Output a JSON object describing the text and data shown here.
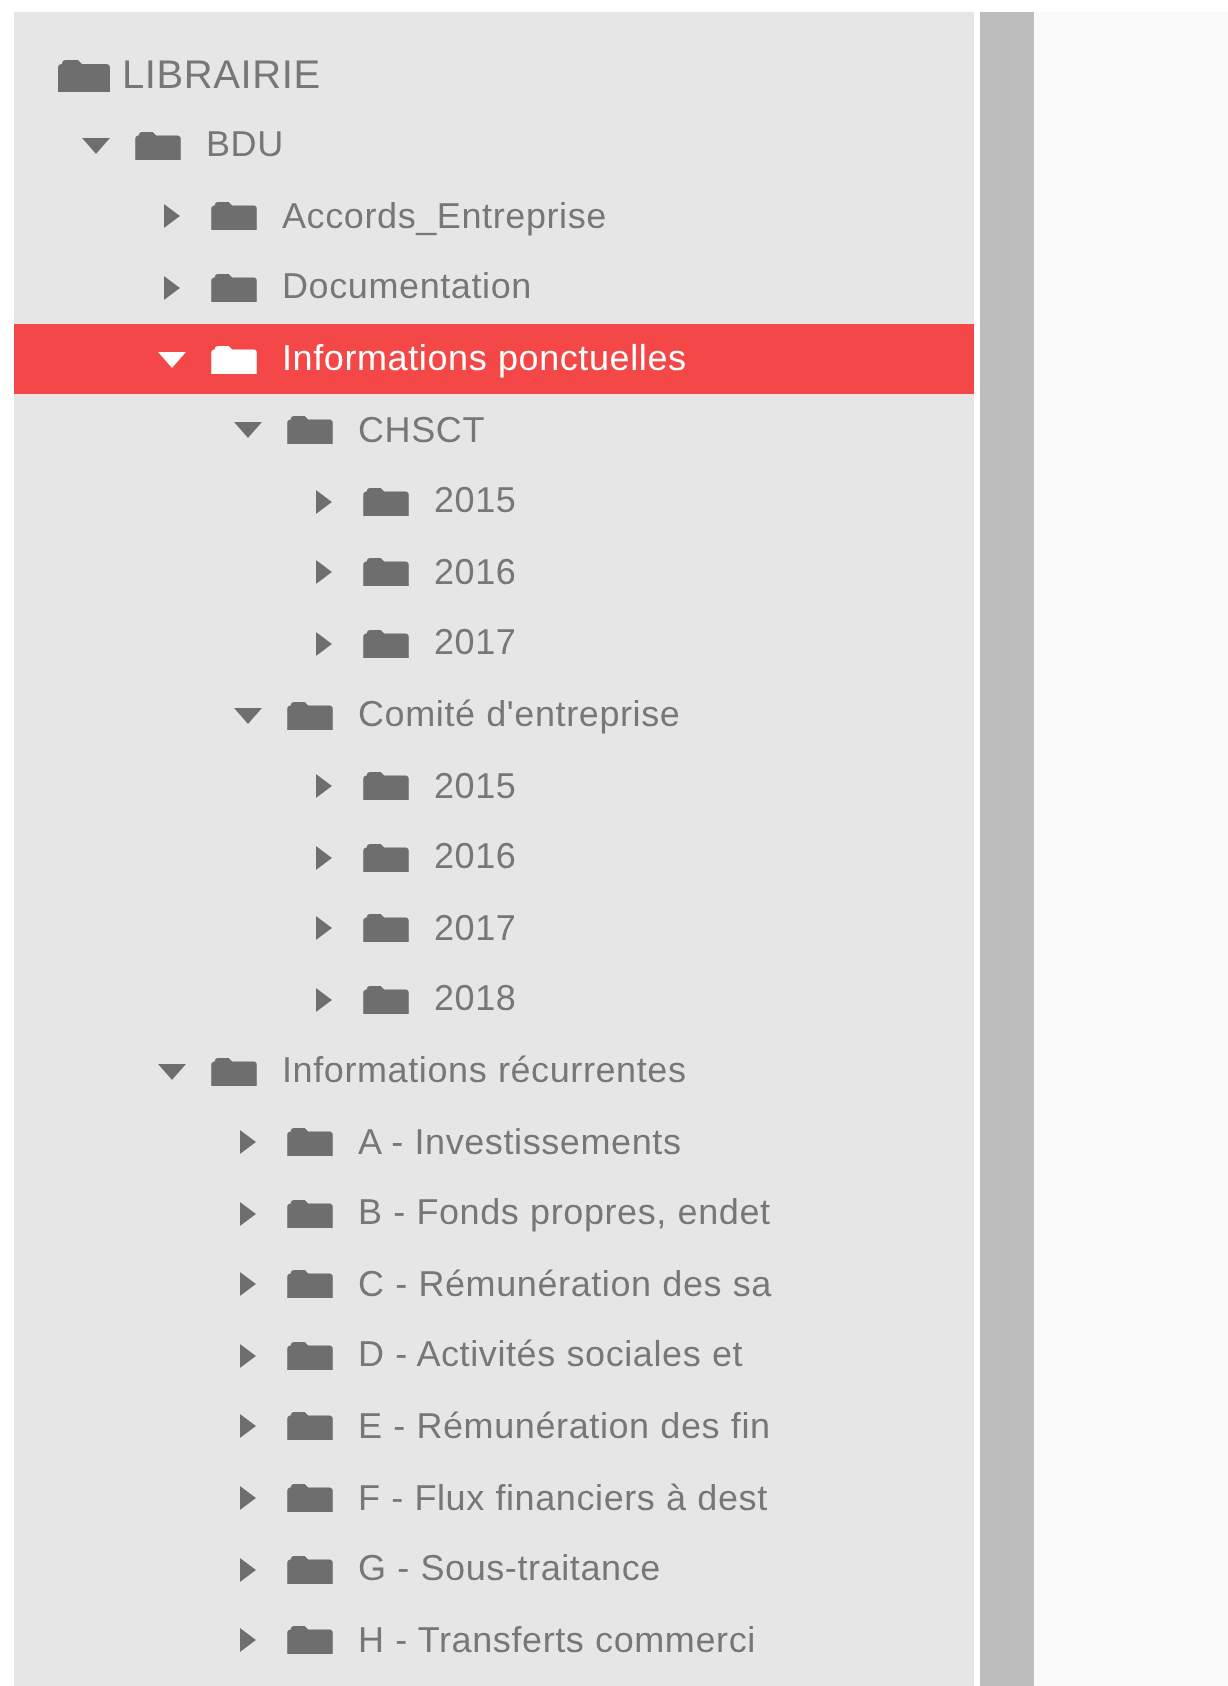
{
  "tree": {
    "label": "LIBRAIRIE",
    "children": [
      {
        "label": "BDU",
        "expanded": true,
        "selected": false,
        "children": [
          {
            "label": "Accords_Entreprise",
            "expanded": false,
            "selected": false
          },
          {
            "label": "Documentation",
            "expanded": false,
            "selected": false
          },
          {
            "label": "Informations ponctuelles",
            "expanded": true,
            "selected": true,
            "children": [
              {
                "label": "CHSCT",
                "expanded": true,
                "selected": false,
                "children": [
                  {
                    "label": "2015",
                    "expanded": false,
                    "selected": false
                  },
                  {
                    "label": "2016",
                    "expanded": false,
                    "selected": false
                  },
                  {
                    "label": "2017",
                    "expanded": false,
                    "selected": false
                  }
                ]
              },
              {
                "label": "Comité d'entreprise",
                "expanded": true,
                "selected": false,
                "children": [
                  {
                    "label": "2015",
                    "expanded": false,
                    "selected": false
                  },
                  {
                    "label": "2016",
                    "expanded": false,
                    "selected": false
                  },
                  {
                    "label": "2017",
                    "expanded": false,
                    "selected": false
                  },
                  {
                    "label": "2018",
                    "expanded": false,
                    "selected": false
                  }
                ]
              }
            ]
          },
          {
            "label": "Informations récurrentes",
            "expanded": true,
            "selected": false,
            "children": [
              {
                "label": "A - Investissements",
                "expanded": false,
                "selected": false
              },
              {
                "label": "B - Fonds propres, endet",
                "expanded": false,
                "selected": false
              },
              {
                "label": "C - Rémunération des sa",
                "expanded": false,
                "selected": false
              },
              {
                "label": "D - Activités sociales et",
                "expanded": false,
                "selected": false
              },
              {
                "label": "E - Rémunération des fin",
                "expanded": false,
                "selected": false
              },
              {
                "label": "F - Flux financiers à dest",
                "expanded": false,
                "selected": false
              },
              {
                "label": "G - Sous-traitance",
                "expanded": false,
                "selected": false
              },
              {
                "label": "H - Transferts commerci",
                "expanded": false,
                "selected": false
              }
            ]
          }
        ]
      }
    ]
  }
}
